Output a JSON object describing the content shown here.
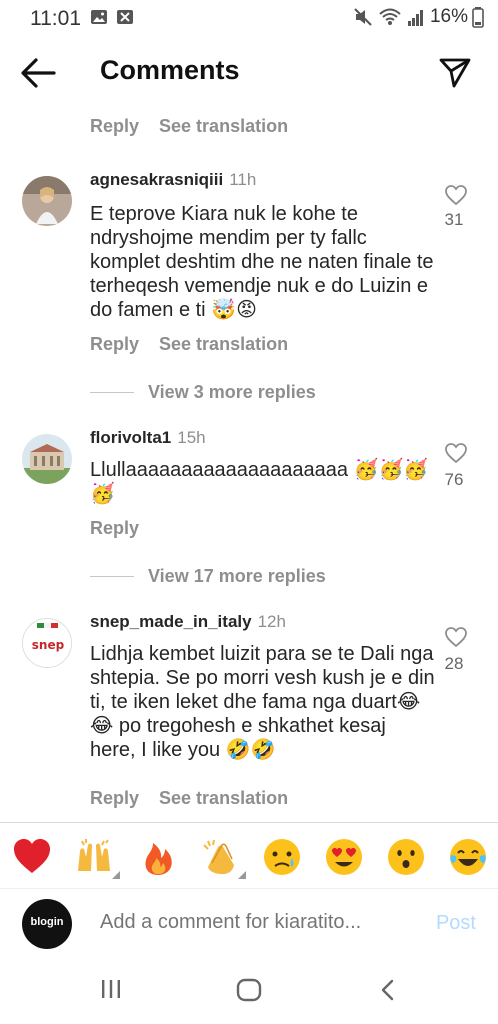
{
  "status": {
    "time": "11:01",
    "battery": "16%"
  },
  "header": {
    "title": "Comments"
  },
  "top_actions": {
    "reply": "Reply",
    "translate": "See translation"
  },
  "comments": [
    {
      "username": "agnesakrasniqiii",
      "time": "11h",
      "text": "E teprove Kiara nuk le kohe te ndryshojme mendim per ty fallc komplet deshtim dhe ne naten finale te terheqesh vemendje nuk e do Luizin e do famen e ti 🤯😡",
      "likes": "31",
      "reply": "Reply",
      "translate": "See translation",
      "view_replies": "View 3 more replies"
    },
    {
      "username": "florivolta1",
      "time": "15h",
      "text": "Llullaaaaaaaaaaaaaaaaaaaa 🥳🥳🥳🥳",
      "likes": "76",
      "reply": "Reply",
      "view_replies": "View 17 more replies"
    },
    {
      "username": "snep_made_in_italy",
      "time": "12h",
      "text": "Lidhja kembet luizit para se te Dali nga shtepia. Se po morri vesh kush je e din ti, te iken leket dhe fama nga duart😂😂 po tregohesh e shkathet kesaj here, I like you 🤣🤣",
      "likes": "28",
      "reply": "Reply",
      "translate": "See translation"
    }
  ],
  "emoji_bar": [
    "❤️",
    "🙌",
    "🔥",
    "👏",
    "😢",
    "😍",
    "😮",
    "😂"
  ],
  "comment_box": {
    "placeholder": "Add a comment for kiaratito...",
    "post": "Post",
    "avatar_text": "blogin"
  }
}
